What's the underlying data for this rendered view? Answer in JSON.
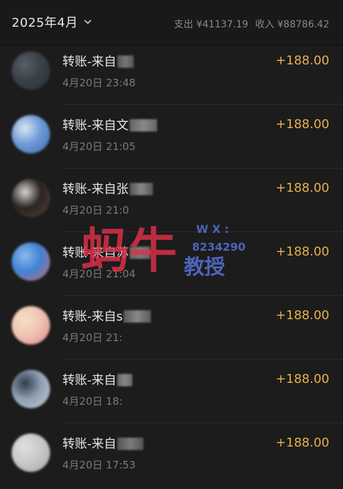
{
  "header": {
    "month": "2025年4月",
    "expense": "支出 ¥41137.19",
    "income": "收入 ¥88786.42"
  },
  "transactions": [
    {
      "title": "转账-来自",
      "date": "4月20日 23:48",
      "amount": "+188.00",
      "avatar": [
        "#3a4048",
        "#5a6068",
        "#2c3138"
      ],
      "mosaic": [
        "#555",
        "#777"
      ]
    },
    {
      "title": "转账-来自文",
      "date": "4月20日 21:05",
      "amount": "+188.00",
      "avatar": [
        "#6f9ad6",
        "#d8e6f4",
        "#3d6db2"
      ],
      "mosaic": [
        "#666",
        "#888"
      ]
    },
    {
      "title": "转账-来自张",
      "date": "4月20日 21:0",
      "amount": "+188.00",
      "avatar": [
        "#2a2422",
        "#d9d4cf",
        "#5b4038"
      ],
      "mosaic": [
        "#555",
        "#888"
      ]
    },
    {
      "title": "转账-来自苏",
      "date": "4月20日 21:04",
      "amount": "+188.00",
      "avatar": [
        "#3f82d6",
        "#8fb8ea",
        "#d46a6a"
      ],
      "mosaic": [
        "#666",
        "#7a7a7a"
      ]
    },
    {
      "title": "转账-来自s",
      "date": "4月20日 21:",
      "amount": "+188.00",
      "avatar": [
        "#f1c3b5",
        "#f6e0c4",
        "#d98a8a"
      ],
      "mosaic": [
        "#5a5a5a",
        "#888"
      ]
    },
    {
      "title": "转账-来自",
      "date": "4月20日 18:",
      "amount": "+188.00",
      "avatar": [
        "#8ea0b4",
        "#2f3a48",
        "#c7ced6"
      ],
      "mosaic": [
        "#666",
        "#888"
      ]
    },
    {
      "title": "转账-来自",
      "date": "4月20日 17:53",
      "amount": "+188.00",
      "avatar": [
        "#c8c8c8",
        "#e0e0e0",
        "#a8a8a8"
      ],
      "mosaic": [
        "#555",
        "#7a7a7a"
      ]
    }
  ],
  "watermark": {
    "text_main": "蚂牛",
    "text_sub": "教授",
    "wx_label": "W X :",
    "wx_number": "8234290",
    "color_main": "#e0304a",
    "color_sub": "#5c7cf0"
  }
}
